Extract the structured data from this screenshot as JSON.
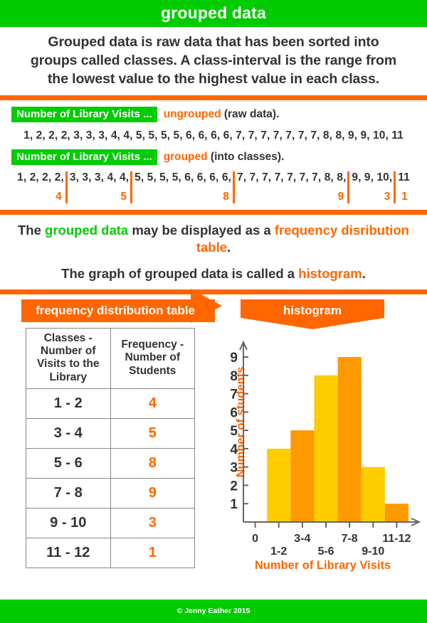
{
  "colors": {
    "green": "#00CC00",
    "orange": "#FF6600",
    "bar_light": "#FFCC00",
    "bar_dark": "#FF9900",
    "text": "#333333"
  },
  "header": {
    "title": "grouped data"
  },
  "intro": {
    "line1": "Grouped data is raw data that has been sorted into",
    "line2": "groups called classes. A class-interval is the range from",
    "line3": "the lowest value to the highest value in each class."
  },
  "ungrouped": {
    "tag": "Number of Library Visits ...",
    "emphasis": "ungrouped",
    "suffix": "(raw data).",
    "values": "1, 2, 2, 2, 3, 3, 3, 4, 4, 5, 5, 5, 5, 6, 6, 6, 6, 7, 7, 7, 7, 7, 7, 7, 8, 8, 9, 9, 10, 11"
  },
  "grouped": {
    "tag": "Number of Library Visits ...",
    "emphasis": "grouped",
    "suffix": "(into classes).",
    "groups": [
      {
        "nums": "1, 2, 2, 2,",
        "count": "4"
      },
      {
        "nums": "3, 3, 3, 4, 4,",
        "count": "5"
      },
      {
        "nums": "5, 5, 5, 5, 6, 6, 6, 6,",
        "count": "8"
      },
      {
        "nums": "7, 7, 7, 7, 7, 7, 7, 8, 8,",
        "count": "9"
      },
      {
        "nums": "9, 9, 10,",
        "count": "3"
      },
      {
        "nums": "11",
        "count": "1"
      }
    ]
  },
  "statements": {
    "s1_a": "The ",
    "s1_green": "grouped data",
    "s1_b": " may be displayed as a ",
    "s1_orange": "frequency disribution table",
    "s1_c": ".",
    "s2_a": "The graph of grouped data is called a ",
    "s2_orange": "histogram",
    "s2_b": "."
  },
  "banners": {
    "table_banner": "frequency distribution table",
    "chart_banner": "histogram"
  },
  "table": {
    "headers": [
      "Classes - Number of Visits to the Library",
      "Frequency - Number of Students"
    ],
    "rows": [
      {
        "classes": "1 - 2",
        "frequency": "4"
      },
      {
        "classes": "3 - 4",
        "frequency": "5"
      },
      {
        "classes": "5 - 6",
        "frequency": "8"
      },
      {
        "classes": "7 - 8",
        "frequency": "9"
      },
      {
        "classes": "9 - 10",
        "frequency": "3"
      },
      {
        "classes": "11 - 12",
        "frequency": "1"
      }
    ]
  },
  "chart_data": {
    "type": "bar",
    "title": "histogram",
    "categories": [
      "1-2",
      "3-4",
      "5-6",
      "7-8",
      "9-10",
      "11-12"
    ],
    "values": [
      4,
      5,
      8,
      9,
      3,
      1
    ],
    "xlabel": "Number of Library Visits",
    "ylabel": "Number of students",
    "ylim": [
      0,
      9
    ],
    "yticks": [
      1,
      2,
      3,
      4,
      5,
      6,
      7,
      8,
      9
    ],
    "xticks": [
      "0",
      "1-2",
      "3-4",
      "5-6",
      "7-8",
      "9-10",
      "11-12"
    ],
    "grid": false,
    "legend": false,
    "bar_colors": [
      "#FFCC00",
      "#FF9900",
      "#FFCC00",
      "#FF9900",
      "#FFCC00",
      "#FF9900"
    ]
  },
  "footer": {
    "copyright": "© Jenny Eather 2015"
  }
}
